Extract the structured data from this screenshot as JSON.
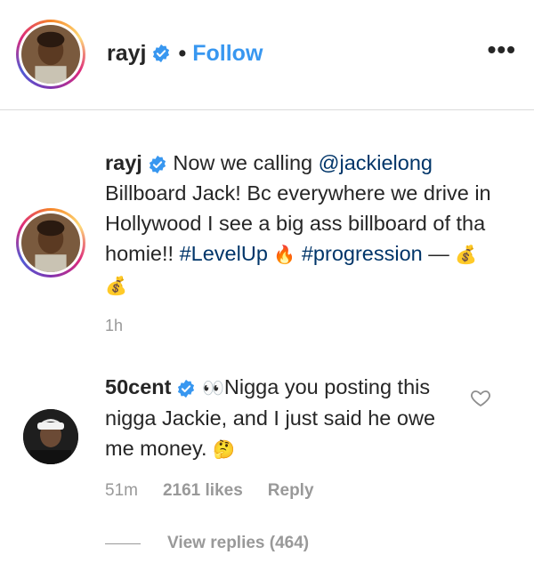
{
  "post_header": {
    "username": "rayj",
    "separator": "•",
    "follow_label": "Follow",
    "more_label": "•••"
  },
  "caption": {
    "username": "rayj",
    "text_a": " Now we calling ",
    "mention": "@jackielong",
    "text_b": " Billboard Jack! Bc everywhere we drive in Hollywood I see a big ass billboard of tha homie!! ",
    "hashtag_1": "#LevelUp",
    "emoji_1": "🔥",
    "hashtag_2": "#progression",
    "text_c": " — ",
    "emoji_2": "💰 💰",
    "time": "1h"
  },
  "comment": {
    "username": "50cent",
    "emoji_eyes": "👀",
    "text": "Nigga you posting this nigga Jackie, and I just said he owe me money. ",
    "emoji_think": "🤔",
    "time": "51m",
    "likes": "2161 likes",
    "reply_label": "Reply",
    "view_replies": "View replies (464)"
  },
  "colors": {
    "accent": "#3897f0",
    "link": "#003569",
    "muted": "#999999"
  }
}
